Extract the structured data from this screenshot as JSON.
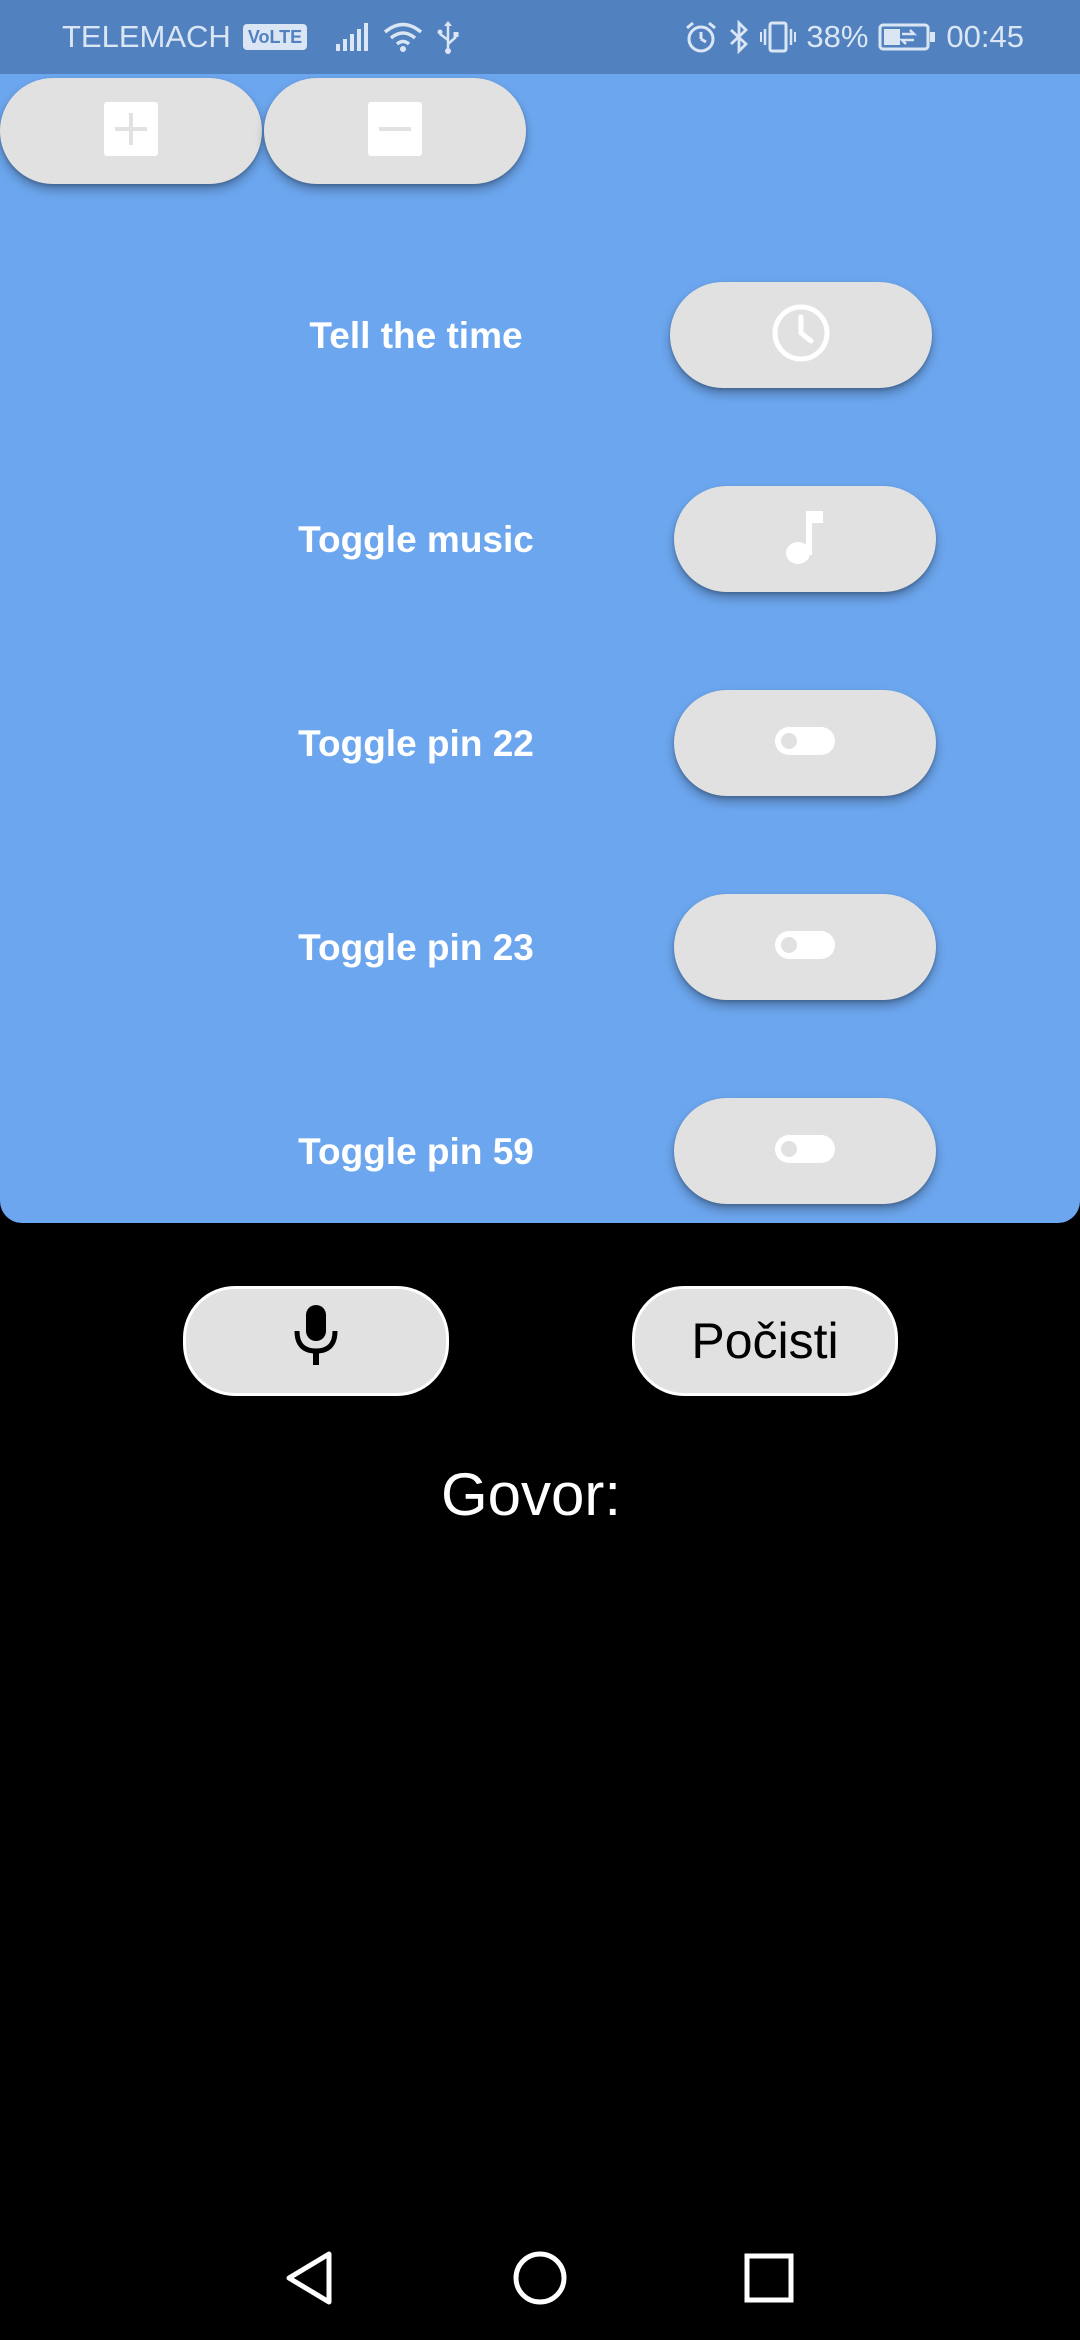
{
  "status_bar": {
    "carrier": "TELEMACH",
    "volte_badge": "VoLTE",
    "battery_percent": "38%",
    "time": "00:45",
    "icons": [
      "signal-icon",
      "wifi-icon",
      "usb-icon",
      "alarm-icon",
      "bluetooth-icon",
      "vibrate-icon",
      "battery-icon"
    ]
  },
  "top_controls": {
    "add_icon": "plus-icon",
    "remove_icon": "minus-icon"
  },
  "commands": [
    {
      "label": "Tell the time",
      "icon": "clock-icon"
    },
    {
      "label": "Toggle music",
      "icon": "music-note-icon"
    },
    {
      "label": "Toggle pin 22",
      "icon": "toggle-icon"
    },
    {
      "label": "Toggle pin 23",
      "icon": "toggle-icon"
    },
    {
      "label": "Toggle pin 59",
      "icon": "toggle-icon"
    }
  ],
  "voice": {
    "mic_icon": "microphone-icon",
    "clear_label": "Počisti",
    "speech_label": "Govor:"
  },
  "colors": {
    "status_bar": "#5281c0",
    "panel": "#6ca6ee",
    "pill": "#e1e1e1",
    "background": "#000000"
  }
}
